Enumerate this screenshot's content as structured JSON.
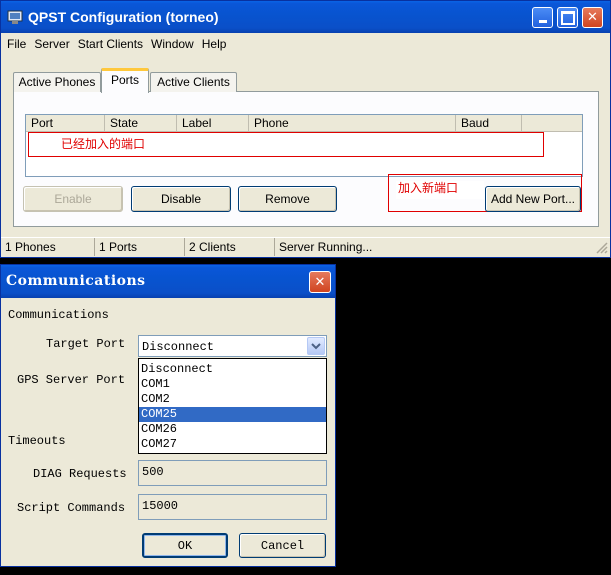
{
  "main_window": {
    "title": "QPST Configuration (torneo)",
    "menu": [
      "File",
      "Server",
      "Start Clients",
      "Window",
      "Help"
    ],
    "tabs": [
      "Active Phones",
      "Ports",
      "Active Clients"
    ],
    "columns": [
      "Port",
      "State",
      "Label",
      "Phone",
      "Baud"
    ],
    "annotation_added": "已经加入的端口",
    "annotation_new": "加入新端口",
    "buttons": {
      "enable": "Enable",
      "disable": "Disable",
      "remove": "Remove",
      "add_new_port": "Add New Port..."
    },
    "status": [
      "1 Phones",
      "1 Ports",
      "2 Clients",
      "Server Running..."
    ]
  },
  "comm_dialog": {
    "title": "Communications",
    "group_label": "Communications",
    "target_port_label": "Target Port",
    "target_port_value": "Disconnect",
    "gps_label": "GPS Server Port",
    "options": [
      "Disconnect",
      "COM1",
      "COM2",
      "COM25",
      "COM26",
      "COM27"
    ],
    "selected_option": "COM25",
    "timeouts_label": "Timeouts",
    "diag_label": "DIAG Requests",
    "diag_value": "500",
    "script_label": "Script Commands",
    "script_value": "15000",
    "ok": "OK",
    "cancel": "Cancel"
  },
  "colors": {
    "title_blue": "#0a54d0",
    "selection": "#316ac5",
    "annotation_red": "#e00000",
    "window_face": "#ece9d8"
  }
}
